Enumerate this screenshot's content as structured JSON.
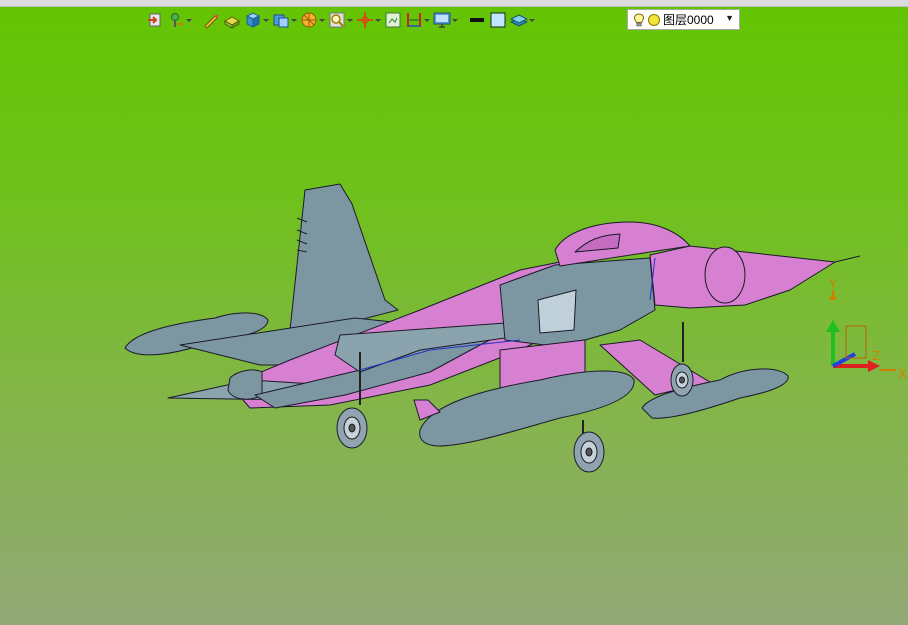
{
  "toolbar": {
    "buttons": [
      {
        "icon": "import-icon",
        "has_dropdown": false
      },
      {
        "icon": "pin-icon",
        "has_dropdown": true
      },
      {
        "icon": "pencil-icon",
        "has_dropdown": false
      },
      {
        "icon": "block-stack-icon",
        "has_dropdown": false
      },
      {
        "icon": "solid-cube-icon",
        "has_dropdown": true
      },
      {
        "icon": "box-view-icon",
        "has_dropdown": true
      },
      {
        "icon": "render-sphere-icon",
        "has_dropdown": true
      },
      {
        "icon": "zoom-icon",
        "has_dropdown": true
      },
      {
        "icon": "move-cursor-icon",
        "has_dropdown": true
      },
      {
        "icon": "frame-icon",
        "has_dropdown": false
      },
      {
        "icon": "measure-icon",
        "has_dropdown": true
      },
      {
        "icon": "display-monitor-icon",
        "has_dropdown": true
      },
      {
        "icon": "line-style-icon",
        "has_dropdown": false
      },
      {
        "icon": "color-swatch-icon",
        "has_dropdown": false
      },
      {
        "icon": "layers-icon",
        "has_dropdown": true
      }
    ],
    "layer_combo": {
      "value": "图层0000",
      "bulb_color": "#f4e43a"
    }
  },
  "viewport": {
    "model": "fighter-jet",
    "colors": {
      "fuselage_pink": "#d77fd0",
      "panel_gray": "#7d97a2",
      "outline": "#1a1a2a",
      "edge_blue": "#2233cc"
    },
    "axis_triad": {
      "x_label": "X",
      "y_label": "Y",
      "z_label": "Z",
      "x_color": "#e02020",
      "y_color": "#20c020",
      "z_color": "#2040e0"
    }
  }
}
